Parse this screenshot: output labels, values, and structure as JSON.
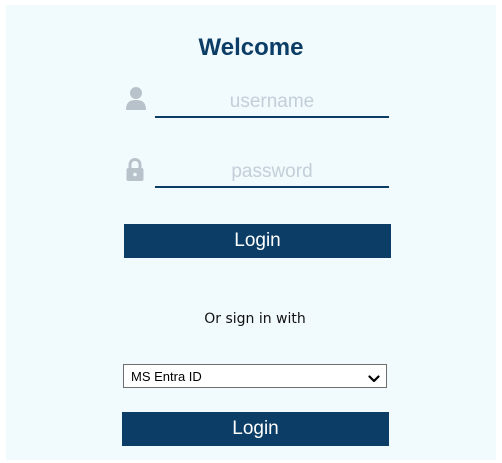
{
  "login": {
    "title": "Welcome",
    "username_placeholder": "username",
    "password_placeholder": "password",
    "login_button_label": "Login"
  },
  "alt_signin": {
    "prompt": "Or sign in with",
    "provider_selected": "MS Entra ID",
    "login_button_label": "Login"
  },
  "icons": {
    "username": "user-icon",
    "password": "lock-icon",
    "dropdown": "chevron-down-icon"
  },
  "colors": {
    "accent": "#0b3d66",
    "panel_background": "#f1fafd",
    "icon_gray": "#b8c2ca",
    "placeholder": "#c3cfd8"
  }
}
